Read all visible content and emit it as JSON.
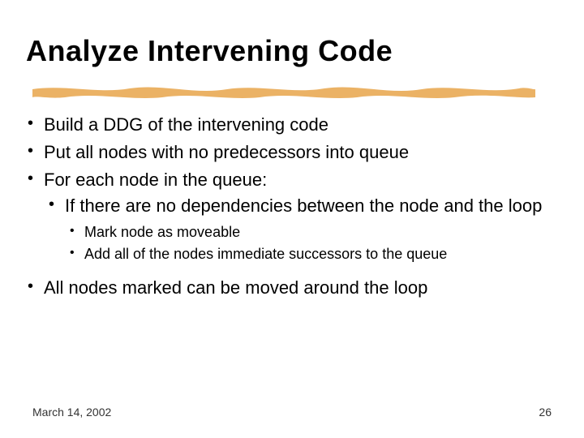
{
  "title": "Analyze Intervening Code",
  "bullets": {
    "b1": "Build a DDG of the intervening code",
    "b2": "Put all nodes with no predecessors into queue",
    "b3": "For each node in the queue:",
    "b3_1": "If there are no dependencies between the node and the loop",
    "b3_1_1": "Mark node as moveable",
    "b3_1_2": "Add all of the nodes immediate successors to the queue",
    "b4": "All nodes marked can be moved around the loop"
  },
  "footer": {
    "date": "March 14, 2002",
    "page": "26"
  },
  "colors": {
    "underline": "#e8a44a"
  }
}
